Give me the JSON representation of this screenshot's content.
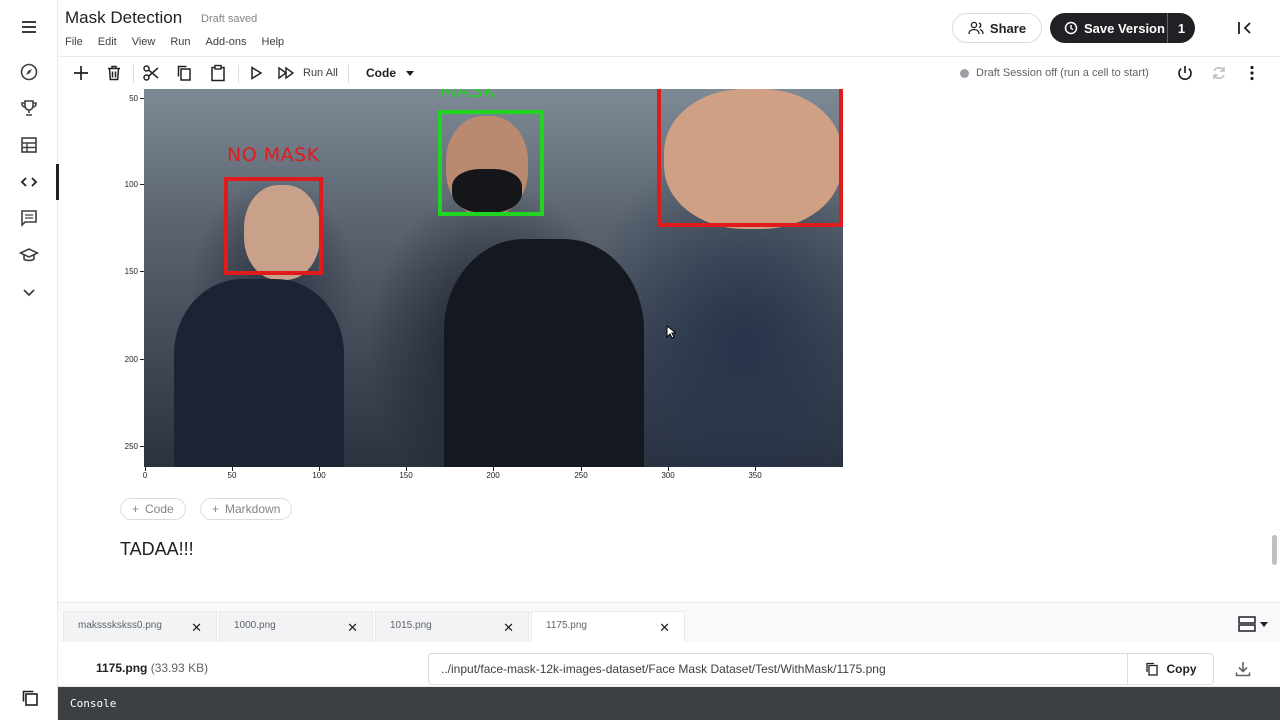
{
  "header": {
    "title": "Mask Detection",
    "draft_status": "Draft saved",
    "menu": [
      "File",
      "Edit",
      "View",
      "Run",
      "Add-ons",
      "Help"
    ],
    "share_label": "Share",
    "save_label": "Save Version",
    "save_count": "1"
  },
  "toolbar": {
    "run_all_label": "Run All",
    "cell_type": "Code",
    "session_status": "Draft Session off (run a cell to start)"
  },
  "rail": {
    "icons": [
      "menu-icon",
      "compass-icon",
      "trophy-icon",
      "table-icon",
      "code-icon",
      "comment-icon",
      "school-icon",
      "chevron-down-icon"
    ]
  },
  "plot": {
    "labels": {
      "no_mask": "NO MASK",
      "mask": "MASK"
    },
    "yticks": [
      "50",
      "100",
      "150",
      "200",
      "250"
    ],
    "xticks": [
      "0",
      "50",
      "100",
      "150",
      "200",
      "250",
      "300",
      "350"
    ]
  },
  "cells": {
    "add_code": "Code",
    "add_markdown": "Markdown",
    "markdown_text": "TADAA!!!"
  },
  "files": {
    "tabs": [
      "makssskskss0.png",
      "1000.png",
      "1015.png",
      "1175.png"
    ],
    "active_tab": "1175.png",
    "current_name": "1175.png",
    "current_size": "(33.93 KB)",
    "path": "../input/face-mask-12k-images-dataset/Face Mask Dataset/Test/WithMask/1175.png",
    "copy_label": "Copy"
  },
  "console": {
    "label": "Console"
  },
  "colors": {
    "no_mask_box": "#e01b1b",
    "mask_box": "#22d322",
    "primary_dark": "#202124"
  }
}
